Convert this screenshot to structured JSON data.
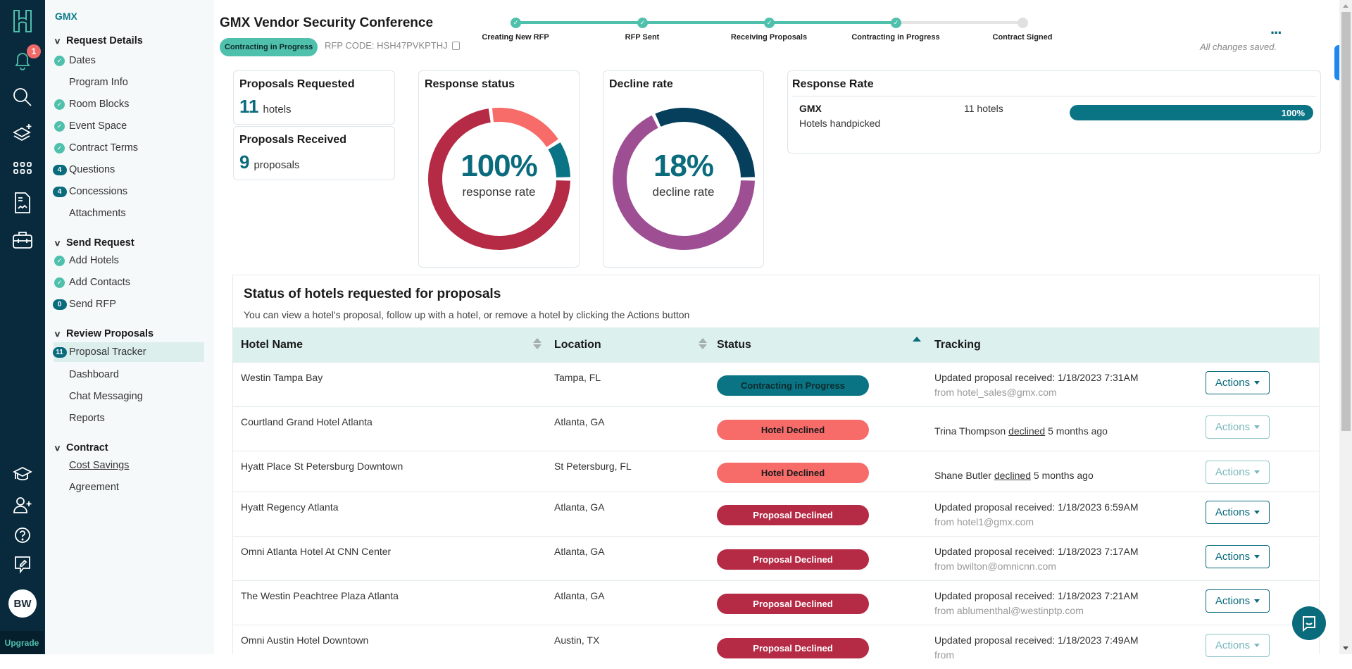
{
  "rail": {
    "icons": [
      "logo-icon",
      "bell-icon",
      "search-icon",
      "layers-plus-icon",
      "grid-icon",
      "document-chart-icon",
      "toolbox-icon",
      "graduation-cap-icon",
      "user-plus-icon",
      "help-icon",
      "feedback-icon"
    ],
    "notification_count": "1",
    "avatar_initials": "BW",
    "upgrade_label": "Upgrade"
  },
  "sidebar": {
    "org": "GMX",
    "sections": [
      {
        "title": "Request Details",
        "items": [
          {
            "label": "Dates",
            "mark": "check"
          },
          {
            "label": "Program Info",
            "mark": ""
          },
          {
            "label": "Room Blocks",
            "mark": "check"
          },
          {
            "label": "Event Space",
            "mark": "check"
          },
          {
            "label": "Contract Terms",
            "mark": "check"
          },
          {
            "label": "Questions",
            "mark": "4"
          },
          {
            "label": "Concessions",
            "mark": "4"
          },
          {
            "label": "Attachments",
            "mark": ""
          }
        ]
      },
      {
        "title": "Send Request",
        "items": [
          {
            "label": "Add Hotels",
            "mark": "check"
          },
          {
            "label": "Add Contacts",
            "mark": "check"
          },
          {
            "label": "Send RFP",
            "mark": "0"
          }
        ]
      },
      {
        "title": "Review Proposals",
        "items": [
          {
            "label": "Proposal Tracker",
            "mark": "11",
            "active": true
          },
          {
            "label": "Dashboard",
            "mark": ""
          },
          {
            "label": "Chat Messaging",
            "mark": ""
          },
          {
            "label": "Reports",
            "mark": ""
          }
        ]
      },
      {
        "title": "Contract",
        "items": [
          {
            "label": "Cost Savings",
            "mark": "",
            "underline": true
          },
          {
            "label": "Agreement",
            "mark": ""
          }
        ]
      }
    ]
  },
  "header": {
    "title": "GMX Vendor Security Conference",
    "status_pill": "Contracting in Progress",
    "rfp_code": "RFP CODE: HSH47PVKPTHJ",
    "saved_text": "All changes saved.",
    "more_label": "..."
  },
  "stepper": {
    "steps": [
      {
        "label": "Creating New RFP",
        "done": true
      },
      {
        "label": "RFP Sent",
        "done": true
      },
      {
        "label": "Receiving Proposals",
        "done": true
      },
      {
        "label": "Contracting in Progress",
        "done": true
      },
      {
        "label": "Contract Signed",
        "done": false
      }
    ]
  },
  "stats": {
    "requested": {
      "title": "Proposals Requested",
      "value": "11",
      "unit": "hotels"
    },
    "received": {
      "title": "Proposals Received",
      "value": "9",
      "unit": "proposals"
    }
  },
  "response_status": {
    "title": "Response status",
    "value": "100%",
    "caption": "response rate",
    "segments": [
      {
        "name": "contracting",
        "fraction": 0.09,
        "color": "#0a7485"
      },
      {
        "name": "proposal-declined",
        "fraction": 0.73,
        "color": "#b52a45"
      },
      {
        "name": "hotel-declined",
        "fraction": 0.18,
        "color": "#f76b69"
      }
    ]
  },
  "decline_rate": {
    "title": "Decline rate",
    "value": "18%",
    "caption": "decline rate",
    "segments": [
      {
        "name": "other",
        "fraction": 0.68,
        "color": "#9e4f94"
      },
      {
        "name": "declined",
        "fraction": 0.32,
        "color": "#053f5c"
      }
    ]
  },
  "response_rate": {
    "title": "Response Rate",
    "org": "GMX",
    "sub": "Hotels handpicked",
    "hotels": "11 hotels",
    "percent": 100,
    "percent_label": "100%"
  },
  "table": {
    "title": "Status of hotels requested for proposals",
    "description": "You can view a hotel's proposal, follow up with a hotel, or remove a hotel by clicking the Actions button",
    "columns": [
      "Hotel Name",
      "Location",
      "Status",
      "Tracking"
    ],
    "action_label": "Actions",
    "rows": [
      {
        "name": "Westin Tampa Bay",
        "location": "Tampa, FL",
        "status": "Contracting in Progress",
        "kind": "contracting",
        "track1": "Updated proposal received: 1/18/2023 7:31AM",
        "track2": "from hotel_sales@gmx.com",
        "dim": false
      },
      {
        "name": "Courtland Grand Hotel Atlanta",
        "location": "Atlanta, GA",
        "status": "Hotel Declined",
        "kind": "hotel",
        "track_person": "Trina Thompson",
        "track_verb": "declined",
        "track_when": "5 months ago",
        "dim": true
      },
      {
        "name": "Hyatt Place St Petersburg Downtown",
        "location": "St Petersburg, FL",
        "status": "Hotel Declined",
        "kind": "hotel",
        "track_person": "Shane Butler",
        "track_verb": "declined",
        "track_when": "5 months ago",
        "dim": true
      },
      {
        "name": "Hyatt Regency Atlanta",
        "location": "Atlanta, GA",
        "status": "Proposal Declined",
        "kind": "proposal",
        "track1": "Updated proposal received: 1/18/2023 6:59AM",
        "track2": "from hotel1@gmx.com",
        "dim": false
      },
      {
        "name": "Omni Atlanta Hotel At CNN Center",
        "location": "Atlanta, GA",
        "status": "Proposal Declined",
        "kind": "proposal",
        "track1": "Updated proposal received: 1/18/2023 7:17AM",
        "track2": "from bwilton@omnicnn.com",
        "dim": false
      },
      {
        "name": "The Westin Peachtree Plaza Atlanta",
        "location": "Atlanta, GA",
        "status": "Proposal Declined",
        "kind": "proposal",
        "track1": "Updated proposal received: 1/18/2023 7:21AM",
        "track2": "from ablumenthal@westinptp.com",
        "dim": false
      },
      {
        "name": "Omni Austin Hotel Downtown",
        "location": "Austin, TX",
        "status": "Proposal Declined",
        "kind": "proposal",
        "track1": "Updated proposal received: 1/18/2023 7:49AM",
        "track2": "from",
        "dim": true
      }
    ]
  },
  "colors": {
    "brand": "#0a6b7d",
    "mint": "#4fc0ac",
    "contracting": "#0a7485",
    "hotel_declined": "#f76b69",
    "proposal_declined": "#b52a45"
  }
}
